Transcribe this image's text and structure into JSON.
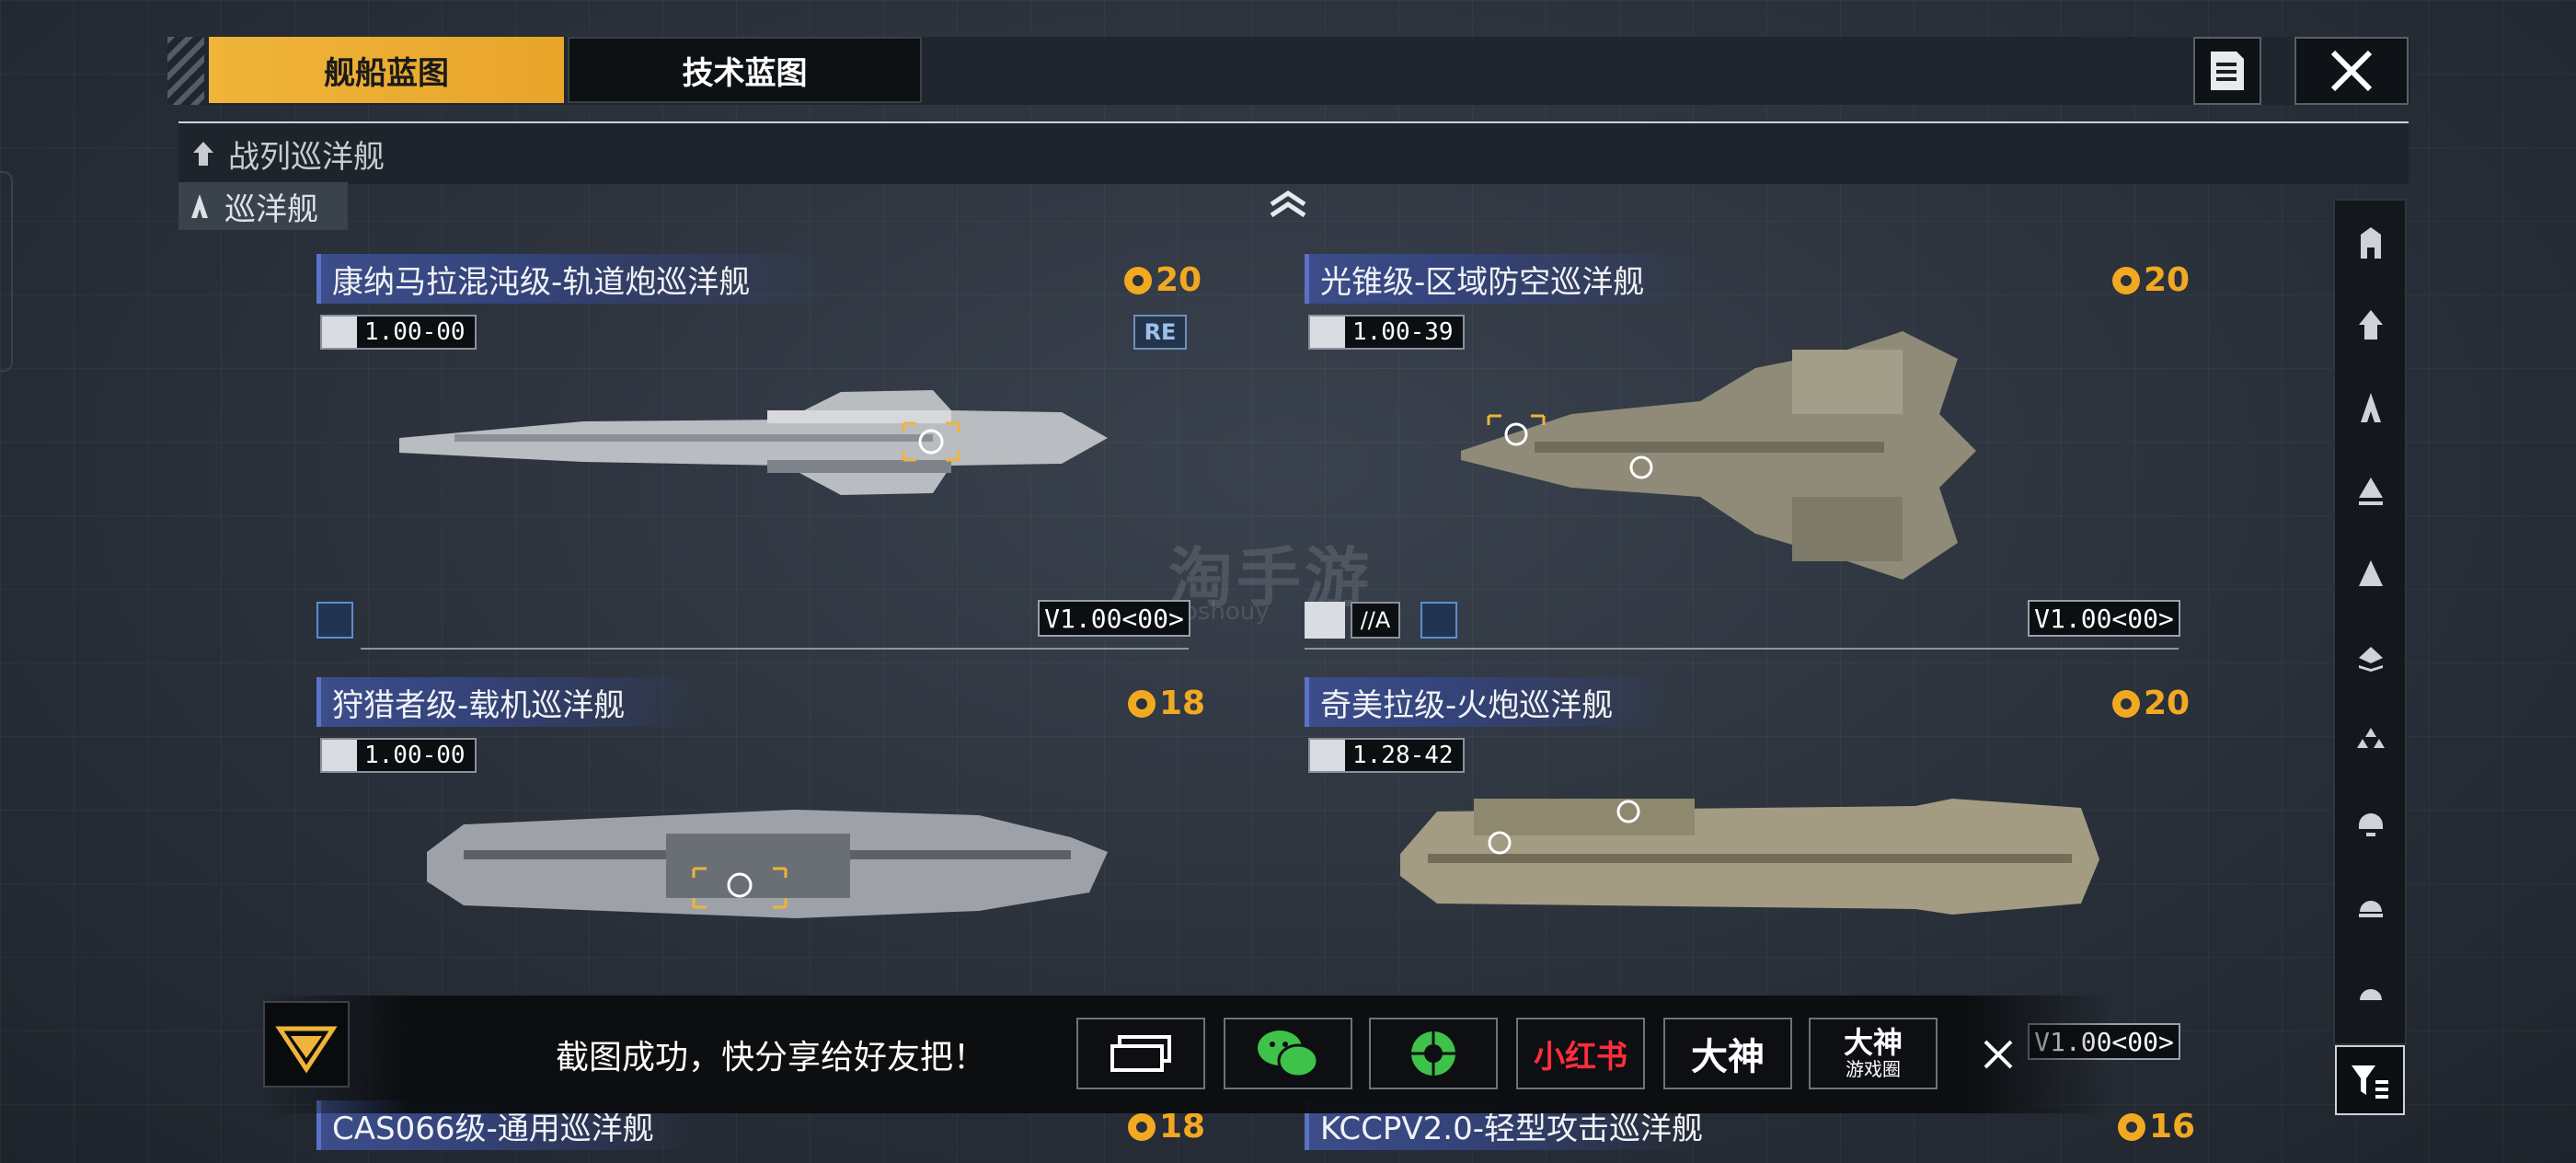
{
  "tabs": [
    {
      "label": "舰船蓝图",
      "active": true
    },
    {
      "label": "技术蓝图",
      "active": false
    }
  ],
  "header_icons": {
    "log": "document-icon",
    "close": "close-icon"
  },
  "categories": {
    "main": "战列巡洋舰",
    "sub": "巡洋舰"
  },
  "cards": [
    {
      "title": "康纳马拉混沌级-轨道炮巡洋舰",
      "cost": "20",
      "version": "1.00-00",
      "badge": "RE",
      "build": "V1.00<00>"
    },
    {
      "title": "光锥级-区域防空巡洋舰",
      "cost": "20",
      "version": "1.00-39",
      "badge_text": "//A",
      "build": "V1.00<00>"
    },
    {
      "title": "狩猎者级-载机巡洋舰",
      "cost": "18",
      "version": "1.00-00"
    },
    {
      "title": "奇美拉级-火炮巡洋舰",
      "cost": "20",
      "version": "1.28-42",
      "build": "V1.00<00>"
    },
    {
      "title": "CAS066级-通用巡洋舰",
      "cost": "18"
    },
    {
      "title": "KCCPV2.0-轻型攻击巡洋舰",
      "cost": "16"
    }
  ],
  "sidebar_icons": [
    "tower-icon",
    "carrier-icon",
    "cruiser-icon",
    "destroyer-icon",
    "frigate-icon",
    "corvette-icon",
    "fighter-icon",
    "station-icon",
    "dome-icon",
    "dome-solid-icon"
  ],
  "toast": {
    "message": "截图成功，快分享给好友把！",
    "buttons": [
      {
        "name": "screen-share",
        "label": ""
      },
      {
        "name": "wechat",
        "label": ""
      },
      {
        "name": "moments",
        "label": ""
      },
      {
        "name": "xiaohongshu",
        "label": "小红书"
      },
      {
        "name": "dashen",
        "label": "大神"
      },
      {
        "name": "dashen-circle",
        "label": "大神",
        "sub": "游戏圈"
      }
    ]
  },
  "watermark": {
    "text": "淘手游",
    "sub": "aoshouy"
  },
  "colors": {
    "accent": "#f0b43a",
    "cost": "#f2a922",
    "title_bg": "#3c4d8a"
  }
}
